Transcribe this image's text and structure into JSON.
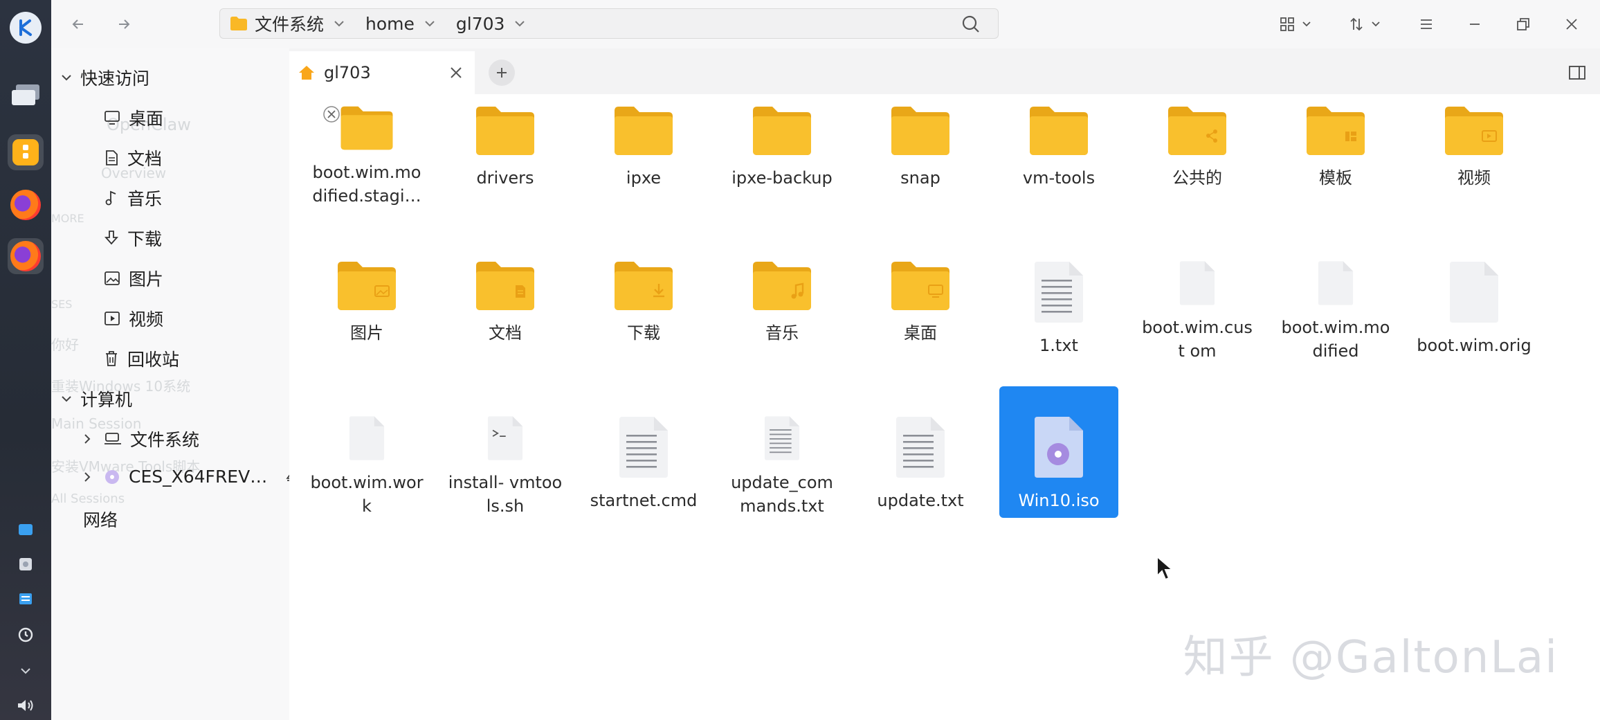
{
  "window": {
    "path": [
      "文件系统",
      "home",
      "gl703"
    ]
  },
  "sidebar": {
    "quick_access_label": "快速访问",
    "quick_items": [
      "桌面",
      "文档",
      "音乐",
      "下载",
      "图片",
      "视频",
      "回收站"
    ],
    "computer_label": "计算机",
    "computer_items": [
      "文件系统",
      "CES_X64FREV…"
    ],
    "network_label": "网络",
    "background_ghost": [
      "OpenClaw",
      "Overview",
      "MORE",
      "SES",
      "你好",
      "重装Windows 10系统",
      "Main Session",
      "安装VMware Tools脚本",
      "All Sessions"
    ]
  },
  "tabs": [
    {
      "label": "gl703"
    }
  ],
  "files": [
    {
      "name": "boot.wim.mo dified.stagi…",
      "kind": "folder",
      "emblem": ""
    },
    {
      "name": "drivers",
      "kind": "folder",
      "emblem": ""
    },
    {
      "name": "ipxe",
      "kind": "folder",
      "emblem": ""
    },
    {
      "name": "ipxe-backup",
      "kind": "folder",
      "emblem": ""
    },
    {
      "name": "snap",
      "kind": "folder",
      "emblem": ""
    },
    {
      "name": "vm-tools",
      "kind": "folder",
      "emblem": ""
    },
    {
      "name": "公共的",
      "kind": "folder",
      "emblem": "share"
    },
    {
      "name": "模板",
      "kind": "folder",
      "emblem": "template"
    },
    {
      "name": "视频",
      "kind": "folder",
      "emblem": "video"
    },
    {
      "name": "图片",
      "kind": "folder",
      "emblem": "image"
    },
    {
      "name": "文档",
      "kind": "folder",
      "emblem": "doc"
    },
    {
      "name": "下载",
      "kind": "folder",
      "emblem": "download"
    },
    {
      "name": "音乐",
      "kind": "folder",
      "emblem": "music"
    },
    {
      "name": "桌面",
      "kind": "folder",
      "emblem": "desktop"
    },
    {
      "name": "1.txt",
      "kind": "text",
      "emblem": ""
    },
    {
      "name": "boot.wim.cust om",
      "kind": "blank",
      "emblem": ""
    },
    {
      "name": "boot.wim.mo dified",
      "kind": "blank",
      "emblem": ""
    },
    {
      "name": "boot.wim.orig",
      "kind": "blank",
      "emblem": ""
    },
    {
      "name": "boot.wim.wor k",
      "kind": "blank",
      "emblem": ""
    },
    {
      "name": "install- vmtools.sh",
      "kind": "script",
      "emblem": ""
    },
    {
      "name": "startnet.cmd",
      "kind": "text",
      "emblem": ""
    },
    {
      "name": "update_com mands.txt",
      "kind": "text",
      "emblem": ""
    },
    {
      "name": "update.txt",
      "kind": "text",
      "emblem": ""
    },
    {
      "name": "Win10.iso",
      "kind": "iso",
      "emblem": "",
      "selected": true
    }
  ],
  "watermark": "知乎 @GaltonLai",
  "colors": {
    "folder": "#f9c02d",
    "selection": "#1f87f2",
    "dock": "#2c3340"
  }
}
